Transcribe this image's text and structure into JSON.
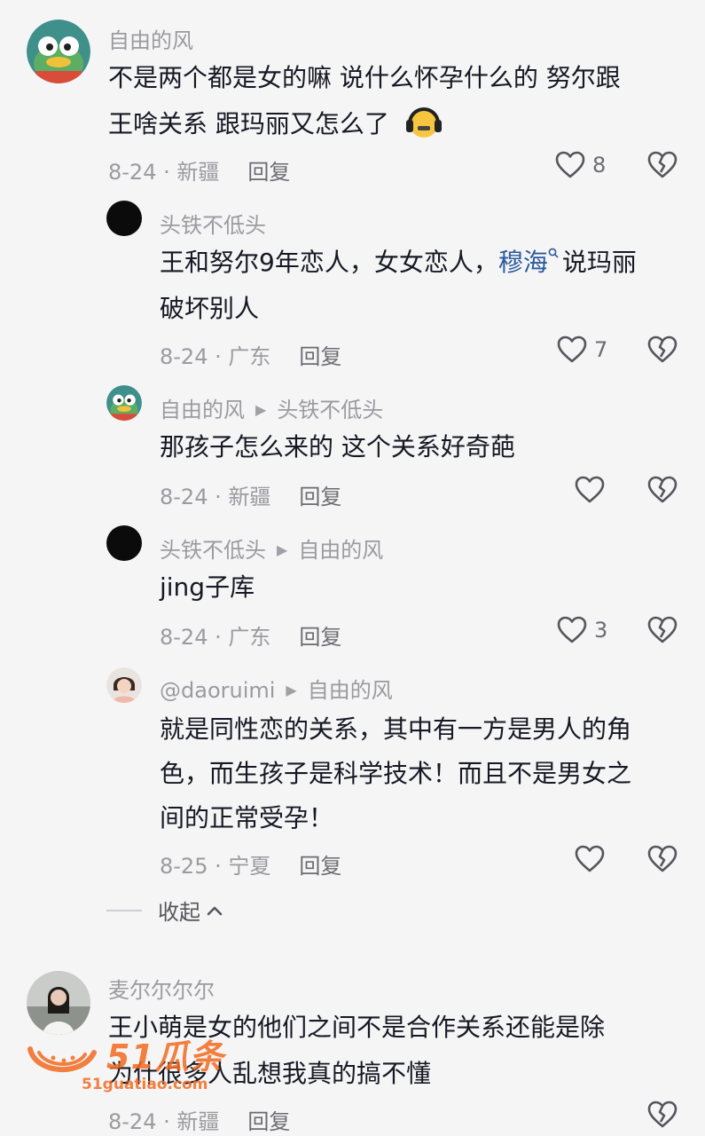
{
  "comments": [
    {
      "user": "自由的风",
      "lines": [
        "不是两个都是女的嘛 说什么怀孕什么的 努尔跟",
        "王啥关系 跟玛丽又怎么了"
      ],
      "meta": "8-24 · 新疆",
      "reply": "回复",
      "likes": "8"
    },
    {
      "user": "头铁不低头",
      "line1_pre": "王和努尔9年恋人，女女恋人，",
      "mention": "穆海",
      "line1_post": "说玛丽",
      "line2": "破坏别人",
      "meta": "8-24 · 广东",
      "reply": "回复",
      "likes": "7"
    },
    {
      "user": "自由的风",
      "reply_to": "头铁不低头",
      "line1": "那孩子怎么来的 这个关系好奇葩",
      "meta": "8-24 · 新疆",
      "reply": "回复"
    },
    {
      "user": "头铁不低头",
      "reply_to": "自由的风",
      "line1": "jing子库",
      "meta": "8-24 · 广东",
      "reply": "回复",
      "likes": "3"
    },
    {
      "user": "@daoruimi",
      "reply_to": "自由的风",
      "lines": [
        "就是同性恋的关系，其中有一方是男人的角",
        "色，而生孩子是科学技术！而且不是男女之",
        "间的正常受孕！"
      ],
      "meta": "8-25 · 宁夏",
      "reply": "回复"
    },
    {
      "user": "麦尔尔尔尔",
      "lines": [
        "王小萌是女的他们之间不是合作关系还能是除",
        "为什很多人乱想我真的搞不懂"
      ],
      "meta": "8-24 · 新疆",
      "reply": "回复"
    }
  ],
  "collapse_label": "收起",
  "watermark": {
    "brand": "51瓜条",
    "url": "51guatiao.com"
  },
  "colors": {
    "mention": "#2b5a9e",
    "watermark": "#f26b20",
    "muted": "#9a9aa0"
  }
}
